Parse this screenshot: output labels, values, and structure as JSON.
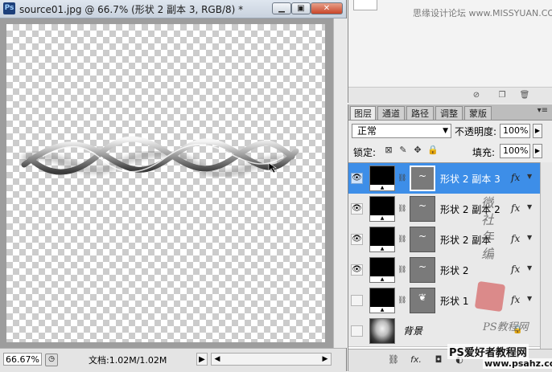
{
  "document": {
    "title": "source01.jpg @ 66.7% (形状 2 副本 3, RGB/8) *",
    "app_icon": "Ps",
    "window_buttons": [
      "minimize-icon",
      "restore-icon",
      "close-icon"
    ],
    "zoom": "66.67%",
    "doc_info": "文档:1.02M/1.02M"
  },
  "top_panel": {
    "watermark": "思缘设计论坛 www.MISSYUAN.COM"
  },
  "layers_panel": {
    "tabs": [
      "图层",
      "通道",
      "路径",
      "调整",
      "蒙版"
    ],
    "active_tab": "图层",
    "blend_mode": "正常",
    "opacity_label": "不透明度:",
    "opacity_value": "100%",
    "lock_label": "锁定:",
    "fill_label": "填充:",
    "fill_value": "100%",
    "layers": [
      {
        "name": "形状 2 副本 3",
        "visible": true,
        "selected": true,
        "fx": "fx"
      },
      {
        "name": "形状 2 副本 2",
        "visible": true,
        "selected": false,
        "fx": "fx"
      },
      {
        "name": "形状 2 副本",
        "visible": true,
        "selected": false,
        "fx": "fx"
      },
      {
        "name": "形状 2",
        "visible": true,
        "selected": false,
        "fx": "fx"
      },
      {
        "name": "形状 1",
        "visible": false,
        "selected": false,
        "fx": "fx"
      }
    ],
    "background_layer": {
      "name": "背景",
      "visible": false
    }
  },
  "watermarks": {
    "site_name": "PS爱好者教程网",
    "site_url": "www.psahz.com",
    "cursive_a": "PS教程网",
    "cursive_b": "微 社 年 编"
  }
}
